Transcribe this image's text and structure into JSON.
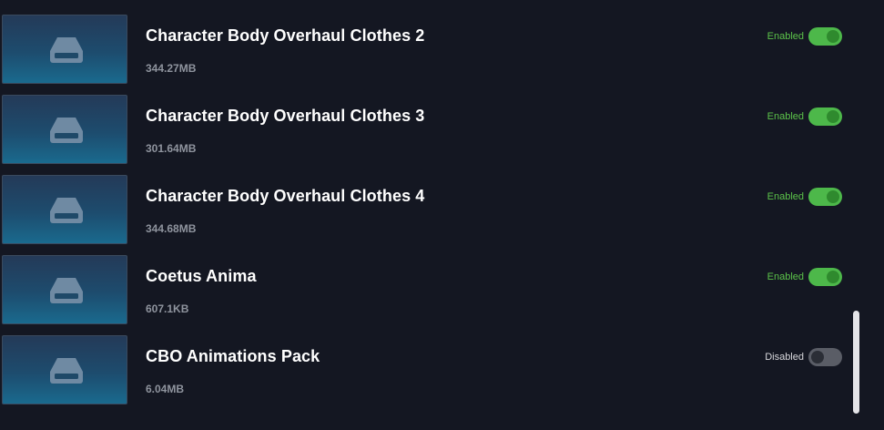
{
  "mods": [
    {
      "name": "Character Body Overhaul Clothes 2",
      "size": "344.27MB",
      "status": "Enabled",
      "enabled": true,
      "icon": "hard-drive-icon"
    },
    {
      "name": "Character Body Overhaul Clothes 3",
      "size": "301.64MB",
      "status": "Enabled",
      "enabled": true,
      "icon": "hard-drive-icon"
    },
    {
      "name": "Character Body Overhaul Clothes 4",
      "size": "344.68MB",
      "status": "Enabled",
      "enabled": true,
      "icon": "hard-drive-icon"
    },
    {
      "name": "Coetus Anima",
      "size": "607.1KB",
      "status": "Enabled",
      "enabled": true,
      "icon": "hard-drive-icon"
    },
    {
      "name": "CBO Animations Pack",
      "size": "6.04MB",
      "status": "Disabled",
      "enabled": false,
      "icon": "hard-drive-icon"
    }
  ],
  "colors": {
    "background": "#141722",
    "enabled_text": "#5cc44a",
    "toggle_on": "#4db84a",
    "toggle_off": "#5a5d66"
  }
}
